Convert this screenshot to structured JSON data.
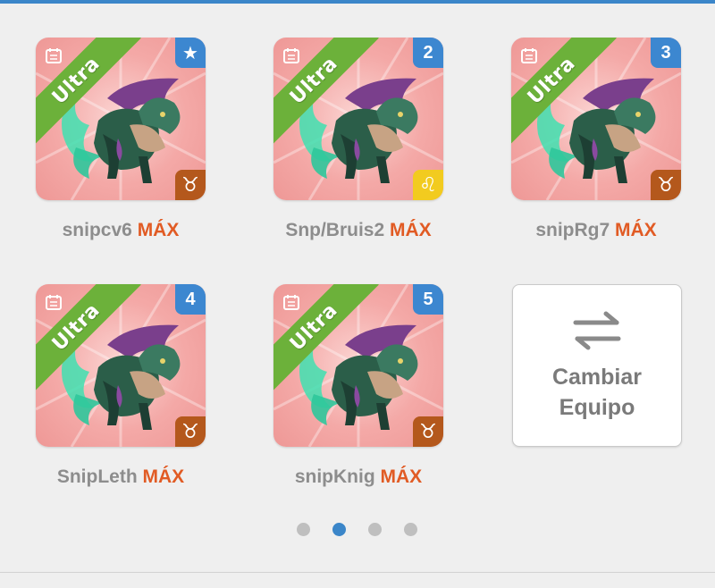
{
  "accent_color": "#3b86c9",
  "max_color": "#e15b24",
  "team": [
    {
      "name": "snipcv6",
      "max": "MÁX",
      "tier": "Ultra",
      "badge": "★",
      "badge_icon": "star-icon",
      "zodiac": "♉",
      "zodiac_name": "taurus"
    },
    {
      "name": "Snp/Bruis2",
      "max": "MÁX",
      "tier": "Ultra",
      "badge": "2",
      "zodiac": "♌",
      "zodiac_name": "leo"
    },
    {
      "name": "snipRg7",
      "max": "MÁX",
      "tier": "Ultra",
      "badge": "3",
      "zodiac": "♉",
      "zodiac_name": "taurus"
    },
    {
      "name": "SnipLeth",
      "max": "MÁX",
      "tier": "Ultra",
      "badge": "4",
      "zodiac": "♉",
      "zodiac_name": "taurus"
    },
    {
      "name": "snipKnig",
      "max": "MÁX",
      "tier": "Ultra",
      "badge": "5",
      "zodiac": "♉",
      "zodiac_name": "taurus"
    }
  ],
  "swap_button": {
    "line1": "Cambiar",
    "line2": "Equipo",
    "icon": "swap-arrows-icon"
  },
  "pagination": {
    "total": 4,
    "current": 2
  }
}
